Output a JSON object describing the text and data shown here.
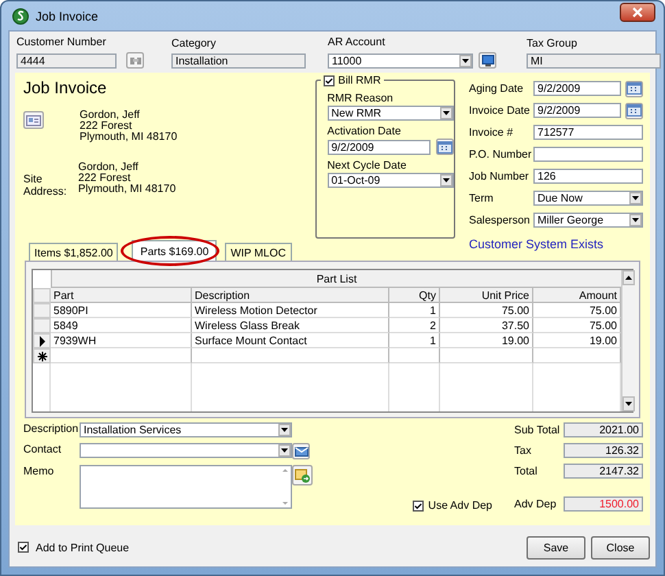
{
  "window": {
    "title": "Job Invoice"
  },
  "header": [
    {
      "label": "Customer Number",
      "value": "4444",
      "kind": "lookup",
      "readonly": true
    },
    {
      "label": "Category",
      "value": "Installation",
      "kind": "text",
      "readonly": true
    },
    {
      "label": "AR Account",
      "value": "11000",
      "kind": "select",
      "readonly": false
    },
    {
      "label": "Tax Group",
      "value": "MI",
      "kind": "text",
      "readonly": true
    }
  ],
  "heading": "Job Invoice",
  "bill_to": {
    "lines": [
      "Gordon, Jeff",
      "222 Forest",
      "Plymouth, MI  48170"
    ]
  },
  "site_address": {
    "label": "Site Address:",
    "lines": [
      "Gordon, Jeff",
      "222 Forest",
      "Plymouth, MI  48170"
    ]
  },
  "rmr": {
    "label": "Bill RMR",
    "checked": true,
    "fields": [
      {
        "label": "RMR Reason",
        "value": "New RMR",
        "kind": "select"
      },
      {
        "label": "Activation Date",
        "value": "9/2/2009",
        "kind": "date"
      },
      {
        "label": "Next Cycle Date",
        "value": "01-Oct-09",
        "kind": "select"
      }
    ]
  },
  "details": [
    {
      "label": "Aging Date",
      "value": "9/2/2009",
      "kind": "date"
    },
    {
      "label": "Invoice Date",
      "value": "9/2/2009",
      "kind": "date"
    },
    {
      "label": "Invoice #",
      "value": "712577",
      "kind": "text"
    },
    {
      "label": "P.O. Number",
      "kind": "text"
    },
    {
      "label": "Job Number",
      "value": "126",
      "kind": "text"
    },
    {
      "label": "Term",
      "value": "Due Now",
      "kind": "select"
    },
    {
      "label": "Salesperson",
      "value": "Miller George",
      "kind": "select"
    }
  ],
  "status_link": "Customer System Exists",
  "tabs": [
    {
      "label": "Items  $1,852.00",
      "selected": false,
      "circled": false
    },
    {
      "label": "Parts  $169.00",
      "selected": true,
      "circled": true
    },
    {
      "label": "WIP MLOC",
      "selected": false,
      "circled": false
    }
  ],
  "table": {
    "title": "Part List",
    "columns": [
      "Part",
      "Description",
      "Qty",
      "Unit Price",
      "Amount"
    ],
    "rows": [
      {
        "cells": [
          "5890PI",
          "Wireless Motion Detector",
          "1",
          "75.00",
          "75.00"
        ],
        "selected": false
      },
      {
        "cells": [
          "5849",
          "Wireless Glass Break",
          "2",
          "37.50",
          "75.00"
        ],
        "selected": false
      },
      {
        "cells": [
          "7939WH",
          "Surface Mount Contact",
          "1",
          "19.00",
          "19.00"
        ],
        "selected": true
      }
    ]
  },
  "footer_fields": [
    {
      "label": "Description",
      "value": "Installation Services",
      "kind": "select"
    },
    {
      "label": "Contact",
      "kind": "select"
    },
    {
      "label": "Memo",
      "kind": "memo"
    }
  ],
  "use_adv_dep": {
    "label": "Use Adv Dep",
    "checked": true
  },
  "totals": [
    {
      "label": "Sub Total",
      "value": "2021.00",
      "kind": "amount"
    },
    {
      "label": "Tax",
      "value": "126.32",
      "kind": "amount"
    },
    {
      "label": "Total",
      "value": "2147.32",
      "kind": "amount"
    },
    {
      "label": "Adv Dep",
      "value": "1500.00",
      "kind": "deposit"
    }
  ],
  "print_queue": {
    "label": "Add to Print Queue",
    "checked": true
  },
  "buttons": [
    "Save",
    "Close"
  ]
}
